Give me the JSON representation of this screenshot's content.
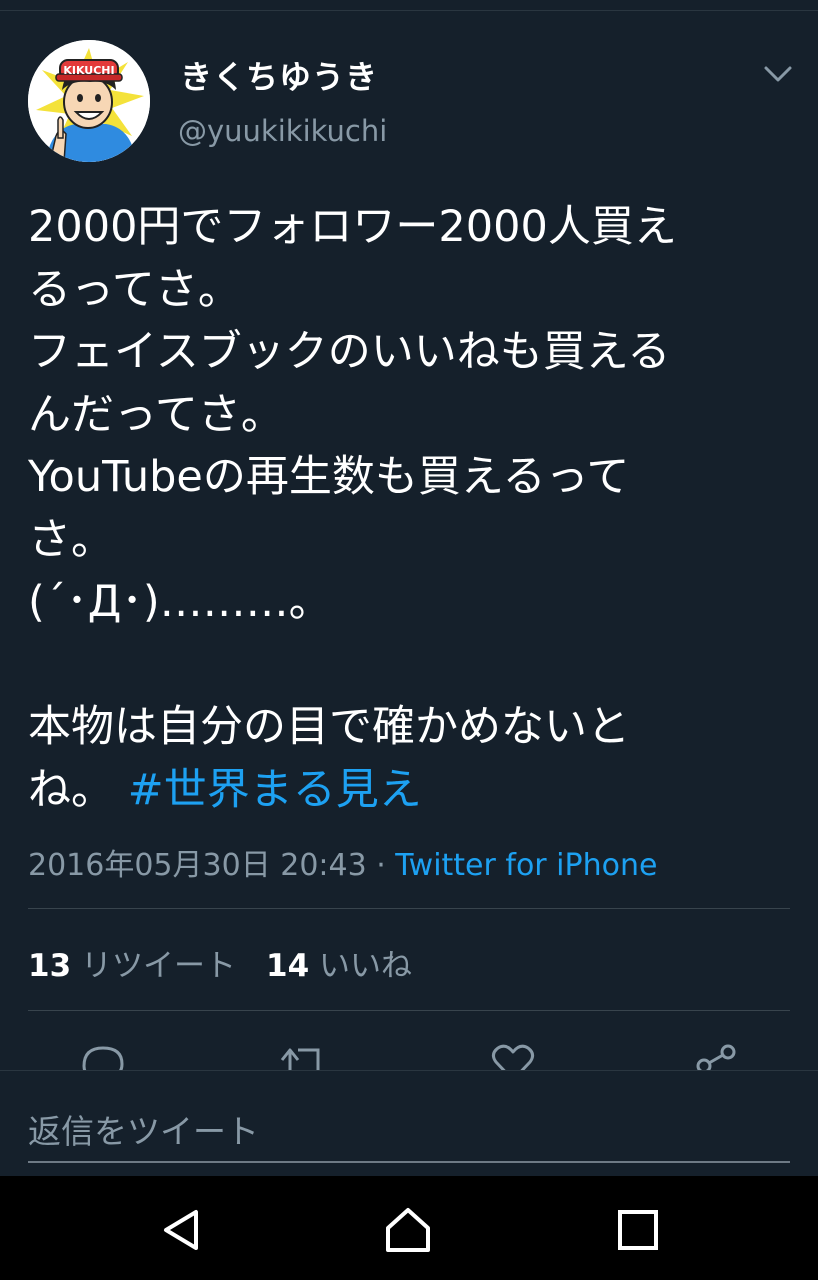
{
  "tweet": {
    "display_name": "きくちゆうき",
    "handle": "@yuukikikuchi",
    "avatar_cap_text": "KIKUCHI",
    "body_lines": [
      "2000円でフォロワー2000人買え",
      "るってさ。",
      "フェイスブックのいいねも買える",
      "んだってさ。",
      "YouTubeの再生数も買えるって",
      "さ。",
      "(´･Д･)………。",
      "",
      "本物は自分の目で確かめないと",
      "ね。"
    ],
    "hashtag": "#世界まる見え",
    "timestamp": "2016年05月30日 20:43",
    "separator": " · ",
    "source": "Twitter for iPhone"
  },
  "stats": {
    "retweets_count": "13",
    "retweets_label": "リツイート",
    "likes_count": "14",
    "likes_label": "いいね"
  },
  "reply": {
    "placeholder": "返信をツイート"
  },
  "icons": {
    "menu": "chevron-down-icon",
    "reply": "reply-icon",
    "retweet": "retweet-icon",
    "like": "heart-icon",
    "share": "share-icon",
    "back": "back-triangle-icon",
    "home": "home-icon",
    "recents": "recents-square-icon"
  },
  "colors": {
    "background": "#15202b",
    "accent": "#1da1f2",
    "secondary_text": "#8899a6",
    "divider": "#38444d"
  }
}
